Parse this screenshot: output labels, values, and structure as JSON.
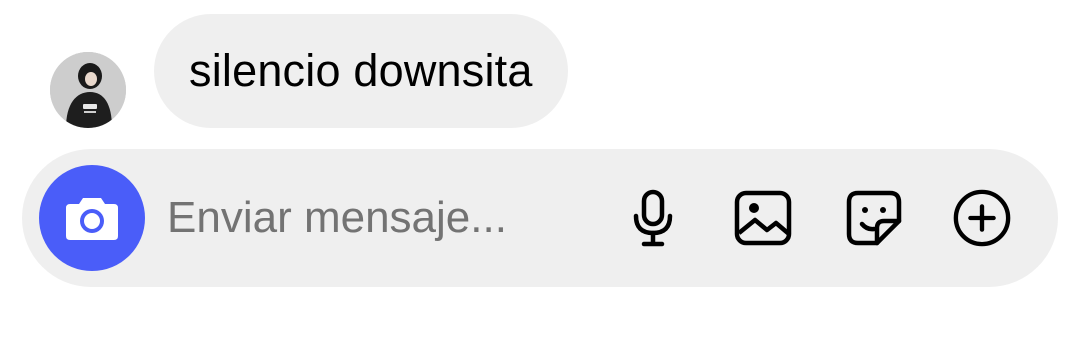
{
  "message": {
    "text": "silencio downsita"
  },
  "composer": {
    "placeholder": "Enviar mensaje...",
    "value": ""
  },
  "icons": {
    "camera": "camera-icon",
    "mic": "microphone-icon",
    "gallery": "image-icon",
    "sticker": "sticker-icon",
    "more": "plus-circle-icon"
  },
  "colors": {
    "accent": "#4a5df9",
    "bubble": "#efefef",
    "placeholder": "#737373"
  }
}
